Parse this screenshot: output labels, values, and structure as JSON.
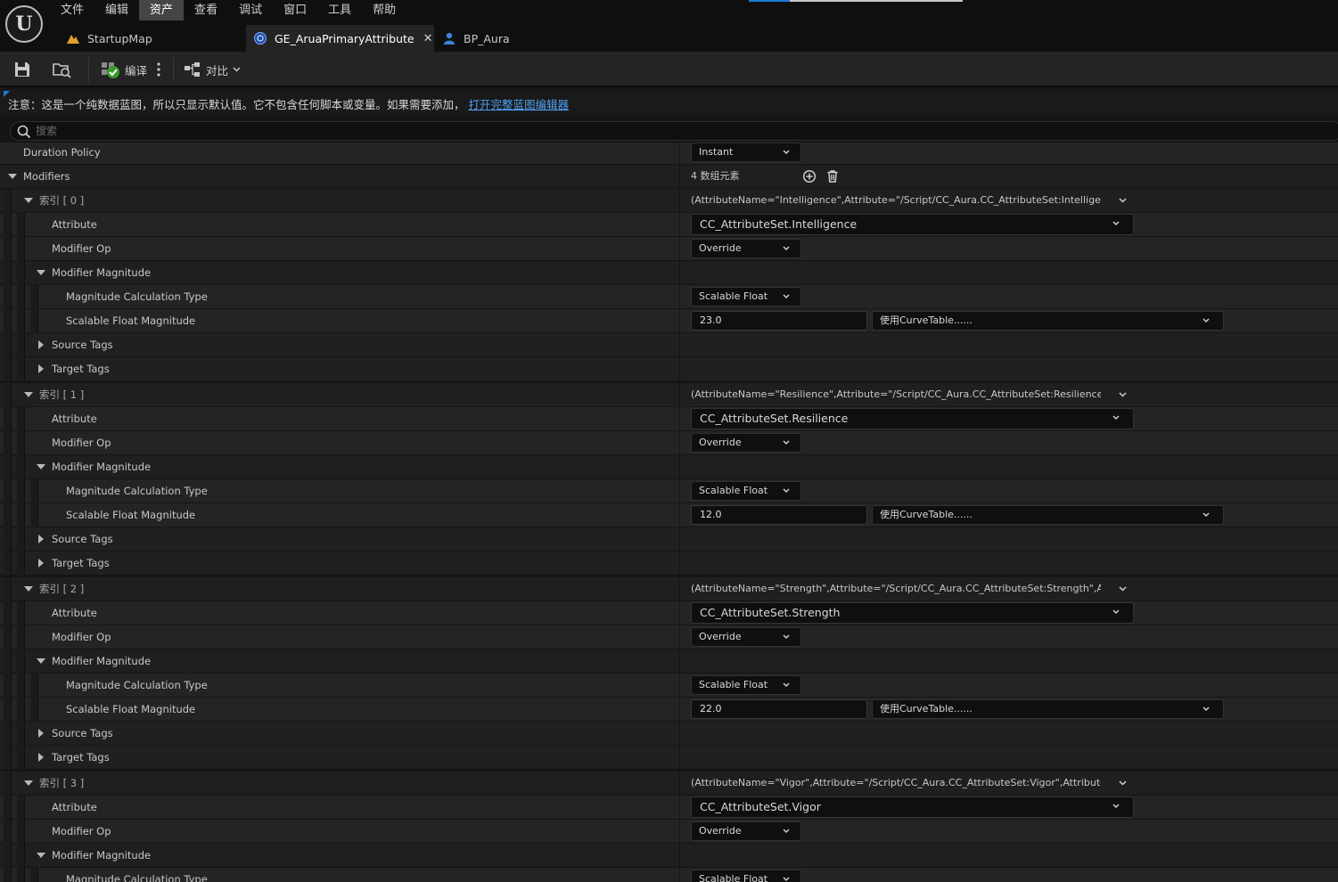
{
  "menu": [
    "文件",
    "编辑",
    "资产",
    "查看",
    "调试",
    "窗口",
    "工具",
    "帮助"
  ],
  "menu_active_index": 2,
  "tabs": [
    {
      "label": "StartupMap",
      "icon": "level-icon"
    },
    {
      "label": "GE_AruaPrimaryAttribute",
      "icon": "gameplay-effect-icon",
      "active": true
    },
    {
      "label": "BP_Aura",
      "icon": "character-icon"
    }
  ],
  "toolbar": {
    "compile_label": "编译",
    "diff_label": "对比"
  },
  "notice": {
    "text": "注意：这是一个纯数据蓝图，所以只显示默认值。它不包含任何脚本或变量。如果需要添加，",
    "link": "打开完整蓝图编辑器"
  },
  "search": {
    "placeholder": "搜索"
  },
  "details": {
    "duration_policy": {
      "label": "Duration Policy",
      "value": "Instant"
    },
    "modifiers": {
      "label": "Modifiers",
      "count": "4 数组元素",
      "labels": {
        "attribute": "Attribute",
        "modifier_op": "Modifier Op",
        "modifier_magnitude": "Modifier Magnitude",
        "calc_type": "Magnitude Calculation Type",
        "scalable": "Scalable Float Magnitude",
        "source_tags": "Source Tags",
        "target_tags": "Target Tags"
      },
      "items": [
        {
          "index_label": "索引 [ 0 ]",
          "summary": "(AttributeName=\"Intelligence\",Attribute=\"/Script/CC_Aura.CC_AttributeSet:Intelligence\",Attri",
          "attribute": "CC_AttributeSet.Intelligence",
          "modifier_op": "Override",
          "calc_type": "Scalable Float",
          "magnitude": "23.0",
          "curve": "使用CurveTable......"
        },
        {
          "index_label": "索引 [ 1 ]",
          "summary": "(AttributeName=\"Resilience\",Attribute=\"/Script/CC_Aura.CC_AttributeSet:Resilience\",Attribu",
          "attribute": "CC_AttributeSet.Resilience",
          "modifier_op": "Override",
          "calc_type": "Scalable Float",
          "magnitude": "12.0",
          "curve": "使用CurveTable......"
        },
        {
          "index_label": "索引 [ 2 ]",
          "summary": "(AttributeName=\"Strength\",Attribute=\"/Script/CC_Aura.CC_AttributeSet:Strength\",AttributeO",
          "attribute": "CC_AttributeSet.Strength",
          "modifier_op": "Override",
          "calc_type": "Scalable Float",
          "magnitude": "22.0",
          "curve": "使用CurveTable......"
        },
        {
          "index_label": "索引 [ 3 ]",
          "summary": "(AttributeName=\"Vigor\",Attribute=\"/Script/CC_Aura.CC_AttributeSet:Vigor\",AttributeOwner=/",
          "attribute": "CC_AttributeSet.Vigor",
          "modifier_op": "Override",
          "calc_type": "Scalable Float",
          "magnitude": "",
          "curve": ""
        }
      ]
    }
  }
}
